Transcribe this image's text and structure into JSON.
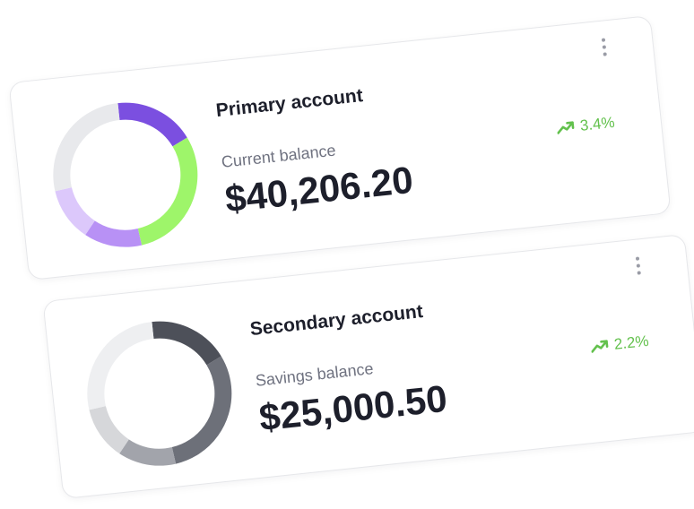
{
  "accounts": [
    {
      "title": "Primary account",
      "balance_label": "Current balance",
      "balance": "$40,206.20",
      "change": "3.4%",
      "trend_icon": "trending-up-icon",
      "menu_icon": "more-vertical-icon",
      "donut_segments": [
        {
          "fraction": 0.18,
          "color": "#7b4fe0"
        },
        {
          "fraction": 0.3,
          "color": "#9ef56a"
        },
        {
          "fraction": 0.13,
          "color": "#b891f5"
        },
        {
          "fraction": 0.12,
          "color": "#dcc8fb"
        },
        {
          "fraction": 0.27,
          "color": "#e8e9ec"
        }
      ]
    },
    {
      "title": "Secondary account",
      "balance_label": "Savings balance",
      "balance": "$25,000.50",
      "change": "2.2%",
      "trend_icon": "trending-up-icon",
      "menu_icon": "more-vertical-icon",
      "donut_segments": [
        {
          "fraction": 0.18,
          "color": "#4d5059"
        },
        {
          "fraction": 0.3,
          "color": "#6d7079"
        },
        {
          "fraction": 0.13,
          "color": "#a2a4ab"
        },
        {
          "fraction": 0.12,
          "color": "#d6d7da"
        },
        {
          "fraction": 0.27,
          "color": "#eeeff1"
        }
      ]
    }
  ],
  "colors": {
    "positive": "#63c14d",
    "text_primary": "#1d1f2b",
    "text_secondary": "#6f7280"
  }
}
